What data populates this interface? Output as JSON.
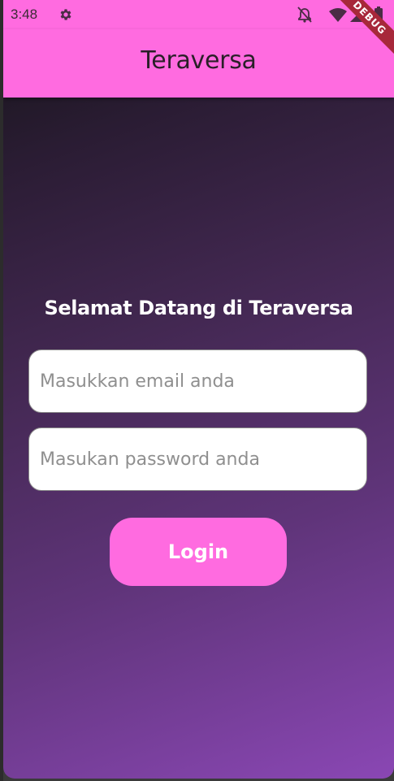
{
  "statusbar": {
    "time": "3:48",
    "icons": [
      "gear-icon",
      "notifications-off-icon",
      "wifi-icon",
      "signal-icon",
      "battery-icon"
    ]
  },
  "appbar": {
    "title": "Teraversa"
  },
  "debug_banner": {
    "label": "DEBUG"
  },
  "login": {
    "welcome": "Selamat Datang di Teraversa",
    "email_placeholder": "Masukkan email anda",
    "email_value": "",
    "password_placeholder": "Masukan password anda",
    "password_value": "",
    "button_label": "Login"
  },
  "colors": {
    "accent": "#ff6be0",
    "gradient_top": "#141416",
    "gradient_bottom": "#8a47b4",
    "text_light": "#ffffff",
    "placeholder": "#8f8f8f"
  }
}
